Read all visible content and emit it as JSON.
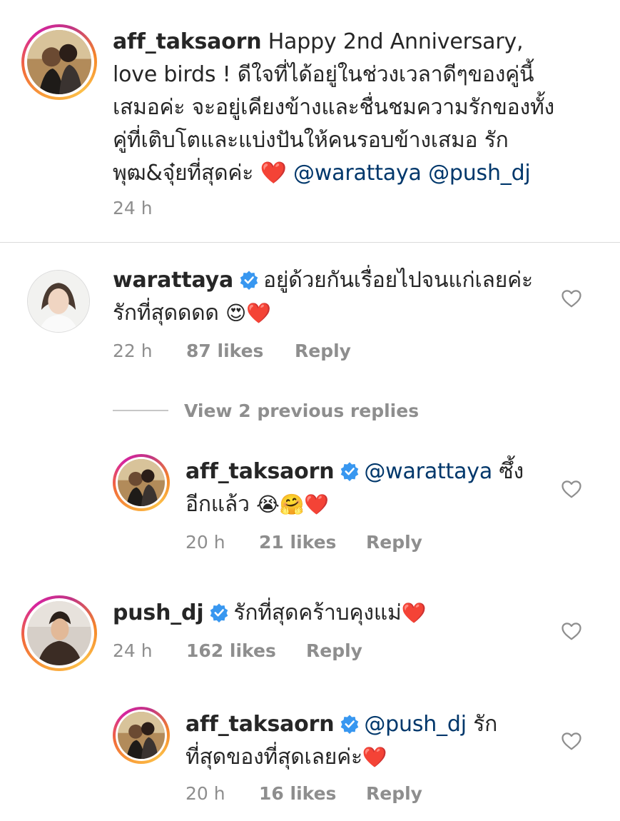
{
  "caption": {
    "username": "aff_taksaorn",
    "text": "Happy 2nd Anniversary, love birds ! ดีใจที่ได้อยู่ในช่วงเวลาดีๆของคู่นี้เสมอค่ะ จะอยู่เคียงข้างและชื่นชมความรักของทั้งคู่ที่เติบโตและแบ่งปันให้คนรอบข้างเสมอ รักพุฒ&จุ๋ยที่สุดค่ะ",
    "heart": "❤️",
    "mention1": "@warattaya",
    "mention2": "@push_dj",
    "time": "24 h"
  },
  "comments": [
    {
      "username": "warattaya",
      "text": "อยู่ด้วยกันเรื่อยไปจนแก่เลยค่ะ รักที่สุดดดด",
      "emojis": "😍❤️",
      "time": "22 h",
      "likes": "87 likes",
      "reply": "Reply"
    },
    {
      "username": "aff_taksaorn",
      "mention": "@warattaya",
      "text": "ซึ้งอีกแล้ว",
      "emojis": "😭🤗❤️",
      "time": "20 h",
      "likes": "21 likes",
      "reply": "Reply"
    },
    {
      "username": "push_dj",
      "text": "รักที่สุดคร้าบคุงแม่",
      "emojis": "❤️",
      "time": "24 h",
      "likes": "162 likes",
      "reply": "Reply"
    },
    {
      "username": "aff_taksaorn",
      "mention": "@push_dj",
      "text": "รักที่สุดของที่สุดเลยค่ะ",
      "emojis": "❤️",
      "time": "20 h",
      "likes": "16 likes",
      "reply": "Reply"
    }
  ],
  "view_replies": "View 2 previous replies",
  "icons": {
    "verified": "verified-badge-icon",
    "like": "heart-outline-icon"
  },
  "colors": {
    "verified": "#3897f0",
    "mention": "#00376b",
    "meta": "#8e8e8e",
    "heart": "#e0102f"
  }
}
